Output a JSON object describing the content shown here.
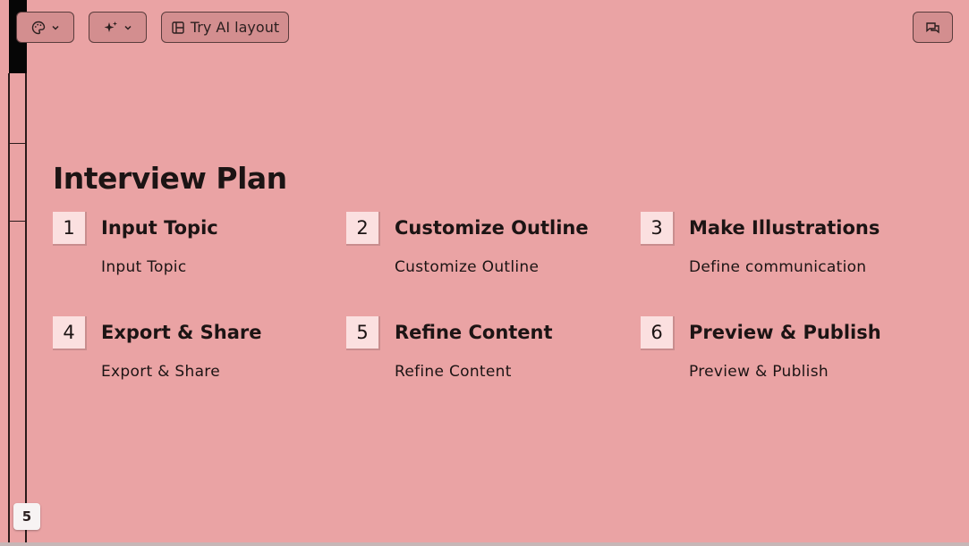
{
  "toolbar": {
    "theme_icon": "palette-icon",
    "magic_icon": "sparkle-icon",
    "ai_layout_label": "Try AI layout",
    "ai_layout_icon": "layout-icon",
    "chat_icon": "chat-icon"
  },
  "slide": {
    "title": "Interview Plan",
    "steps": [
      {
        "number": "1",
        "title": "Input Topic",
        "description": "Input Topic"
      },
      {
        "number": "2",
        "title": "Customize Outline",
        "description": "Customize Outline"
      },
      {
        "number": "3",
        "title": "Make Illustrations",
        "description": "Define communication"
      },
      {
        "number": "4",
        "title": "Export & Share",
        "description": "Export & Share"
      },
      {
        "number": "5",
        "title": "Refine Content",
        "description": "Refine Content"
      },
      {
        "number": "6",
        "title": "Preview & Publish",
        "description": "Preview & Publish"
      }
    ]
  },
  "page_number": "5",
  "colors": {
    "slide_background": "#eaa3a4",
    "number_box": "#fbe0e0",
    "text": "#1c1414"
  }
}
